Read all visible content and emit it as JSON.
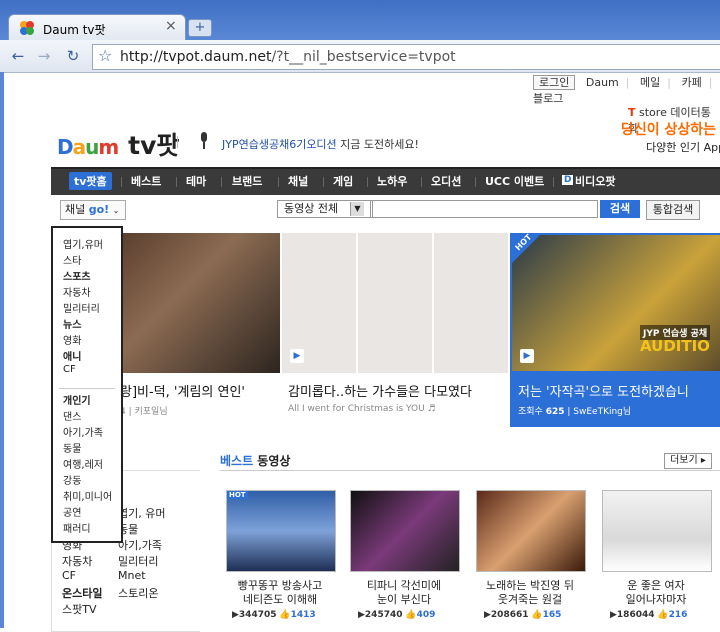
{
  "browser": {
    "tab_title": "Daum tv팟",
    "tab_close": "×",
    "new_tab": "+",
    "url_domain": "http://tvpot.daum.net",
    "url_path": "/?t__nil_bestservice=tvpot"
  },
  "top_links": [
    "로그인",
    "Daum",
    "메일",
    "카페",
    "블로그"
  ],
  "ad": {
    "line1_brand": "T",
    "line1": "store 데이터통화",
    "line2": "당신이 상상하는 모",
    "line3": "다양한 인기 App"
  },
  "logo": {
    "daum": "Daum",
    "tv": "tv팟"
  },
  "promo": {
    "highlight": "JYP연습생공채6기오디션",
    "rest": " 지금 도전하세요!"
  },
  "main_nav": [
    "tv팟홈",
    "베스트",
    "테마",
    "브랜드",
    "채널",
    "게임",
    "노하우",
    "오디션",
    "UCC 이벤트",
    "비디오팟"
  ],
  "search": {
    "channel_label": "채널",
    "channel_go": "go!",
    "scope": "동영상 전체",
    "button": "검색",
    "combined": "통합검색"
  },
  "channel_menu": {
    "items": [
      "엽기,유머",
      "스타",
      "스포츠",
      "자동차",
      "밀리터리",
      "뉴스",
      "영화",
      "애니",
      "CF"
    ],
    "bold": [
      "스포츠",
      "뉴스",
      "애니"
    ],
    "items2": [
      "개인기",
      "댄스",
      "아기,가족",
      "동물",
      "여행,레저",
      "강동",
      "취미,미니어",
      "공연",
      "패러디"
    ],
    "bold2": [
      "개인기"
    ]
  },
  "left_list": {
    "col1": [
      "영화",
      "자동차",
      "CF",
      "온스타일",
      "스팟TV"
    ],
    "col2": [
      "엽기, 유머",
      "동물",
      "아기,가족",
      "밀리터리",
      "Mnet",
      "스토리온"
    ]
  },
  "featured": [
    {
      "title": "랑]비-덕, '계림의 연인'",
      "views": "4",
      "author": "키포일님"
    },
    {
      "title": "감미롭다..하는 가수들은 다모였다",
      "meta": "All I went for Christmas is YOU ♬"
    },
    {
      "title": "저는 '자작곡'으로 도전하겠습니",
      "views_label": "조회수",
      "views": "625",
      "author": "SwEeTKing님",
      "badge": "HOT",
      "overlay1": "JYP 연습생 공채",
      "overlay2": "AUDITIO"
    }
  ],
  "best": {
    "title_blue": "베스트",
    "title_rest": " 동영상",
    "more": "더보기 ▸",
    "items": [
      {
        "title1": "빵꾸똥꾸 방송사고",
        "title2": "네티즌도 이해해",
        "views": "344705",
        "likes": "1413",
        "badge": "HOT"
      },
      {
        "title1": "티파니 각선미에",
        "title2": "눈이 부신다",
        "views": "245740",
        "likes": "409"
      },
      {
        "title1": "노래하는 박진영 뒤",
        "title2": "웃겨죽는 원걸",
        "views": "208661",
        "likes": "165"
      },
      {
        "title1": "운 좋은 여자",
        "title2": "일어나자마자",
        "views": "186044",
        "likes": "216"
      }
    ]
  },
  "colors": {
    "accent": "#2c6fd6",
    "nav_bg": "#3a3a3a",
    "promo_orange": "#ff6a00"
  }
}
